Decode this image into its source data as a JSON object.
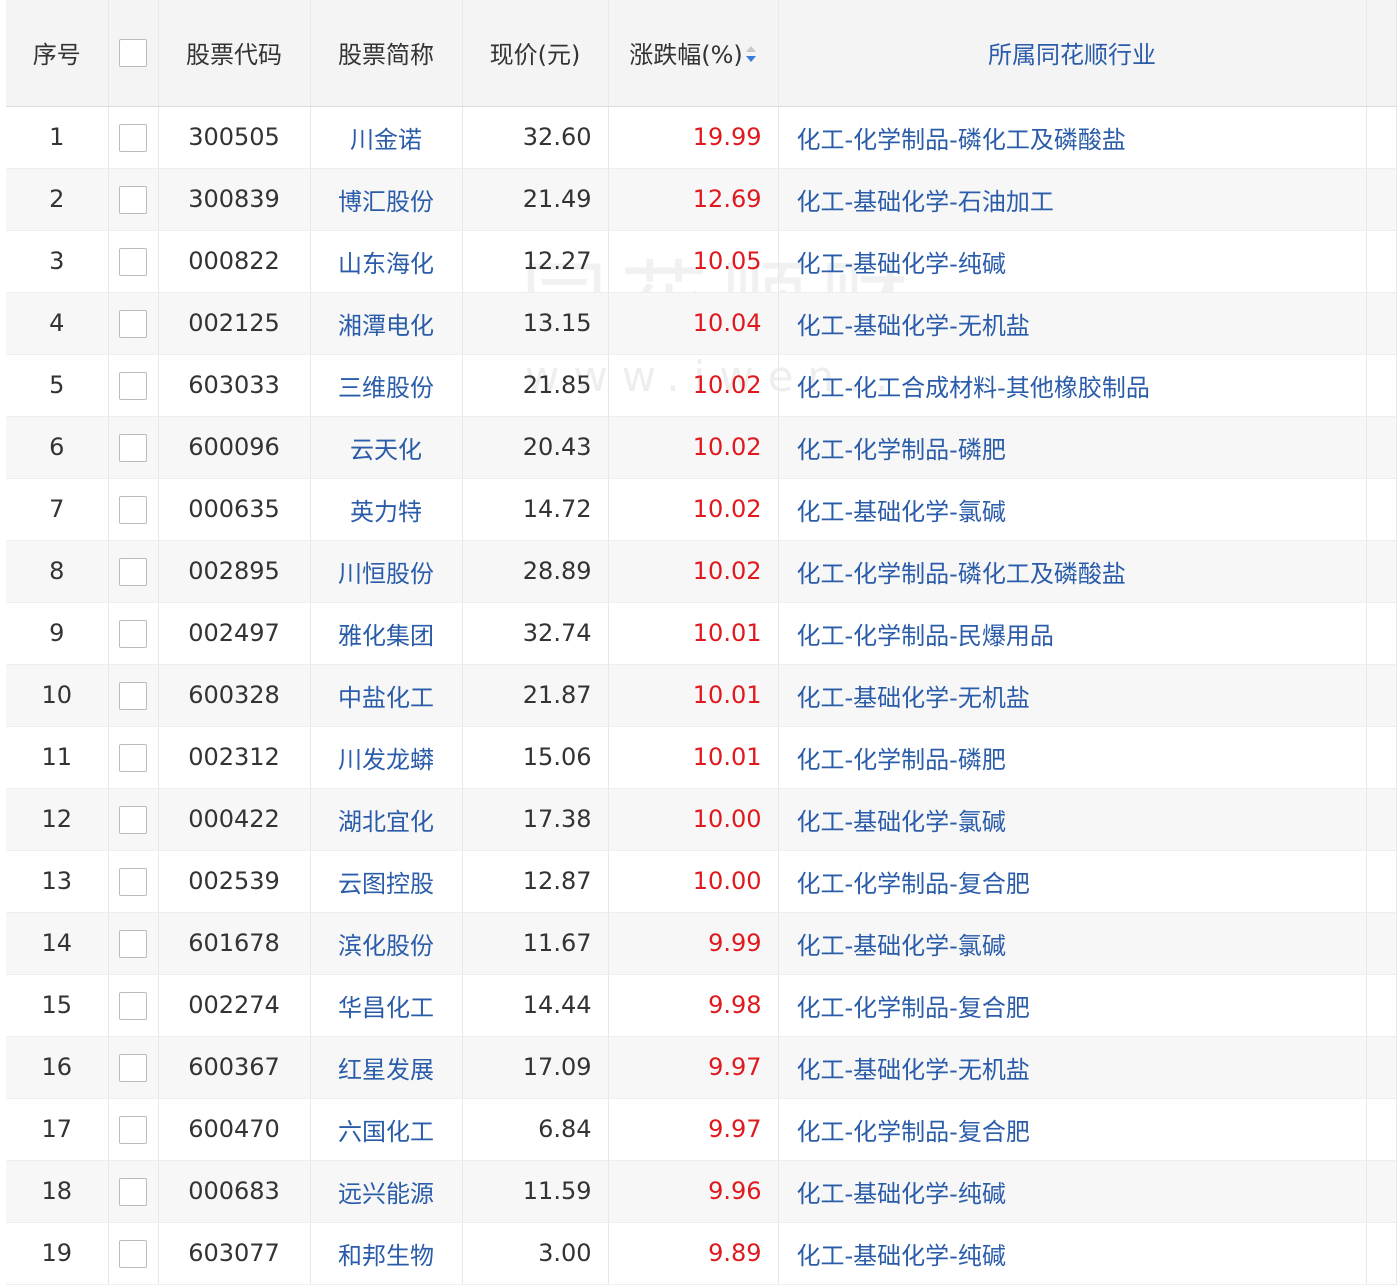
{
  "watermark": {
    "text": "同花顺财",
    "url": "www.iwen..."
  },
  "table": {
    "headers": {
      "index": "序号",
      "code": "股票代码",
      "name": "股票简称",
      "price": "现价(元)",
      "change": "涨跌幅(%)",
      "industry": "所属同花顺行业"
    },
    "sort": {
      "column": "change",
      "direction": "descending",
      "icon": "sort-arrows-icon",
      "active_color": "#3a7bd5"
    },
    "colors": {
      "link": "#2a5caa",
      "up": "#e0191e"
    },
    "rows": [
      {
        "index": "1",
        "code": "300505",
        "name": "川金诺",
        "price": "32.60",
        "change": "19.99",
        "industry": "化工-化学制品-磷化工及磷酸盐"
      },
      {
        "index": "2",
        "code": "300839",
        "name": "博汇股份",
        "price": "21.49",
        "change": "12.69",
        "industry": "化工-基础化学-石油加工"
      },
      {
        "index": "3",
        "code": "000822",
        "name": "山东海化",
        "price": "12.27",
        "change": "10.05",
        "industry": "化工-基础化学-纯碱"
      },
      {
        "index": "4",
        "code": "002125",
        "name": "湘潭电化",
        "price": "13.15",
        "change": "10.04",
        "industry": "化工-基础化学-无机盐"
      },
      {
        "index": "5",
        "code": "603033",
        "name": "三维股份",
        "price": "21.85",
        "change": "10.02",
        "industry": "化工-化工合成材料-其他橡胶制品"
      },
      {
        "index": "6",
        "code": "600096",
        "name": "云天化",
        "price": "20.43",
        "change": "10.02",
        "industry": "化工-化学制品-磷肥"
      },
      {
        "index": "7",
        "code": "000635",
        "name": "英力特",
        "price": "14.72",
        "change": "10.02",
        "industry": "化工-基础化学-氯碱"
      },
      {
        "index": "8",
        "code": "002895",
        "name": "川恒股份",
        "price": "28.89",
        "change": "10.02",
        "industry": "化工-化学制品-磷化工及磷酸盐"
      },
      {
        "index": "9",
        "code": "002497",
        "name": "雅化集团",
        "price": "32.74",
        "change": "10.01",
        "industry": "化工-化学制品-民爆用品"
      },
      {
        "index": "10",
        "code": "600328",
        "name": "中盐化工",
        "price": "21.87",
        "change": "10.01",
        "industry": "化工-基础化学-无机盐"
      },
      {
        "index": "11",
        "code": "002312",
        "name": "川发龙蟒",
        "price": "15.06",
        "change": "10.01",
        "industry": "化工-化学制品-磷肥"
      },
      {
        "index": "12",
        "code": "000422",
        "name": "湖北宜化",
        "price": "17.38",
        "change": "10.00",
        "industry": "化工-基础化学-氯碱"
      },
      {
        "index": "13",
        "code": "002539",
        "name": "云图控股",
        "price": "12.87",
        "change": "10.00",
        "industry": "化工-化学制品-复合肥"
      },
      {
        "index": "14",
        "code": "601678",
        "name": "滨化股份",
        "price": "11.67",
        "change": "9.99",
        "industry": "化工-基础化学-氯碱"
      },
      {
        "index": "15",
        "code": "002274",
        "name": "华昌化工",
        "price": "14.44",
        "change": "9.98",
        "industry": "化工-化学制品-复合肥"
      },
      {
        "index": "16",
        "code": "600367",
        "name": "红星发展",
        "price": "17.09",
        "change": "9.97",
        "industry": "化工-基础化学-无机盐"
      },
      {
        "index": "17",
        "code": "600470",
        "name": "六国化工",
        "price": "6.84",
        "change": "9.97",
        "industry": "化工-化学制品-复合肥"
      },
      {
        "index": "18",
        "code": "000683",
        "name": "远兴能源",
        "price": "11.59",
        "change": "9.96",
        "industry": "化工-基础化学-纯碱"
      },
      {
        "index": "19",
        "code": "603077",
        "name": "和邦生物",
        "price": "3.00",
        "change": "9.89",
        "industry": "化工-基础化学-纯碱"
      }
    ]
  }
}
